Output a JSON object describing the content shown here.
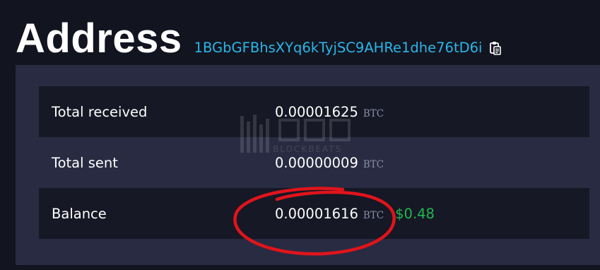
{
  "header": {
    "title": "Address",
    "address": "1BGbGFBhsXYq6kTyjSC9AHRe1dhe76tD6i",
    "copy_icon": "clipboard-copy-icon"
  },
  "summary": {
    "rows": [
      {
        "label": "Total received",
        "amount": "0.00001625",
        "unit": "BTC"
      },
      {
        "label": "Total sent",
        "amount": "0.00000009",
        "unit": "BTC"
      },
      {
        "label": "Balance",
        "amount": "0.00001616",
        "unit": "BTC",
        "usd": "$0.48"
      }
    ]
  },
  "watermark": {
    "text": "BLOCKBEATS"
  },
  "colors": {
    "background": "#121420",
    "panel": "#282b41",
    "row_dark": "#161825",
    "link": "#2ab6e7",
    "usd_green": "#1fb84f",
    "annotation_red": "#e0141b"
  }
}
